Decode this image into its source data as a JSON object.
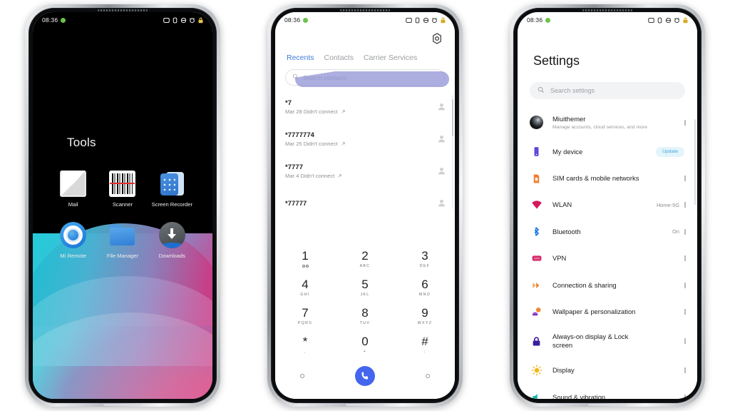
{
  "statusbar": {
    "time": "08:36",
    "icons": [
      "dnd-icon",
      "vibrate-icon",
      "sync-icon",
      "alarm-icon",
      "lock-icon"
    ]
  },
  "phone1": {
    "name": "home-screen",
    "folder_title": "Tools",
    "apps": [
      {
        "label": "Mail",
        "icon": "mail-icon"
      },
      {
        "label": "Scanner",
        "icon": "barcode-scanner-icon"
      },
      {
        "label": "Screen Recorder",
        "icon": "screen-recorder-icon"
      },
      {
        "label": "Mi Remote",
        "icon": "mi-remote-icon"
      },
      {
        "label": "File Manager",
        "icon": "folder-icon"
      },
      {
        "label": "Downloads",
        "icon": "download-icon"
      }
    ]
  },
  "phone2": {
    "name": "phone-dialer",
    "settings_icon": "gear-icon",
    "tabs": [
      {
        "label": "Recents",
        "active": true
      },
      {
        "label": "Contacts",
        "active": false
      },
      {
        "label": "Carrier Services",
        "active": false
      }
    ],
    "search": {
      "placeholder": "Search contacts",
      "value": "",
      "icon": "search-icon"
    },
    "calls": [
      {
        "number": "*7",
        "detail": "Mar 28 Didn't connect",
        "direction": "outgoing"
      },
      {
        "number": "*7777774",
        "detail": "Mar 25 Didn't connect",
        "direction": "outgoing"
      },
      {
        "number": "*7777",
        "detail": "Mar 4 Didn't connect",
        "direction": "outgoing"
      },
      {
        "number": "*77777",
        "detail": "",
        "direction": "outgoing"
      }
    ],
    "keypad": [
      {
        "digit": "1",
        "sub": "",
        "voicemail": true
      },
      {
        "digit": "2",
        "sub": "ABC"
      },
      {
        "digit": "3",
        "sub": "DEF"
      },
      {
        "digit": "4",
        "sub": "GHI"
      },
      {
        "digit": "5",
        "sub": "JKL"
      },
      {
        "digit": "6",
        "sub": "MNO"
      },
      {
        "digit": "7",
        "sub": "PQRS"
      },
      {
        "digit": "8",
        "sub": "TUV"
      },
      {
        "digit": "9",
        "sub": "WXYZ"
      },
      {
        "digit": "*",
        "sub": ","
      },
      {
        "digit": "0",
        "sub": "+"
      },
      {
        "digit": "#",
        "sub": ";"
      }
    ],
    "call_button": "call-button",
    "accent": "#4466ef",
    "tab_active_color": "#3f7bd6"
  },
  "phone3": {
    "name": "settings-app",
    "title": "Settings",
    "search": {
      "placeholder": "Search settings",
      "icon": "search-icon"
    },
    "account": {
      "name": "Miuithemer",
      "subtitle": "Manage accounts, cloud services, and more"
    },
    "items": [
      {
        "label": "My device",
        "value": "",
        "badge": "Update",
        "icon": "device-icon",
        "color": "#6149d8"
      },
      {
        "label": "SIM cards & mobile networks",
        "value": "",
        "icon": "sim-card-icon",
        "color": "#ef7e32"
      },
      {
        "label": "WLAN",
        "value": "Home-5G",
        "icon": "wifi-icon",
        "color": "#d6175c"
      },
      {
        "label": "Bluetooth",
        "value": "On",
        "icon": "bluetooth-icon",
        "color": "#1a73e8"
      },
      {
        "label": "VPN",
        "value": "",
        "icon": "vpn-icon",
        "color": "#d62b6a"
      },
      {
        "label": "Connection & sharing",
        "value": "",
        "icon": "connection-sharing-icon",
        "color": "#f07a21"
      },
      {
        "label": "Wallpaper & personalization",
        "value": "",
        "icon": "wallpaper-icon",
        "color": "#9c42d1"
      },
      {
        "label": "Always-on display & Lock screen",
        "value": "",
        "icon": "lock-icon",
        "color": "#3a1f9e"
      },
      {
        "label": "Display",
        "value": "",
        "icon": "brightness-icon",
        "color": "#f5b519"
      },
      {
        "label": "Sound & vibration",
        "value": "",
        "icon": "sound-icon",
        "color": "#17b8a6"
      }
    ]
  }
}
